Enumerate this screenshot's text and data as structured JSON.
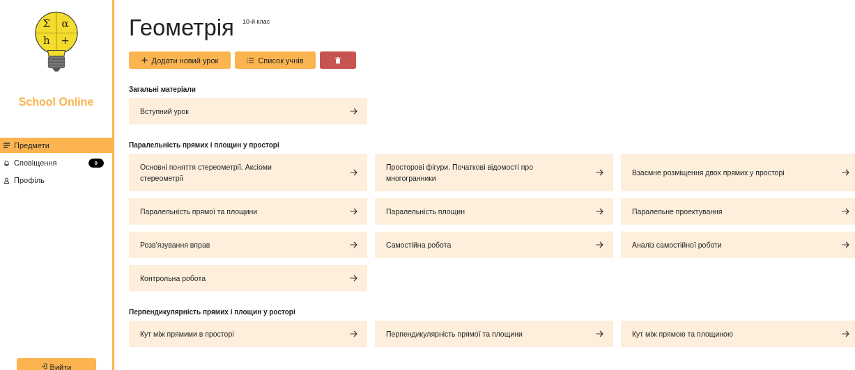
{
  "sidebar": {
    "logo_symbols": [
      "Σ",
      "α",
      "h",
      "+"
    ],
    "brand": "School Online",
    "nav": [
      {
        "kind": "subjects",
        "label": "Предмети",
        "selected": true
      },
      {
        "kind": "notifications",
        "label": "Сповіщення",
        "badge": "0",
        "selected": false
      },
      {
        "kind": "profile",
        "label": "Профіль",
        "selected": false
      }
    ],
    "logout": "Вийти"
  },
  "header": {
    "title": "Геометрія",
    "grade": "10-й клас"
  },
  "actions": [
    {
      "kind": "add",
      "label": "Додати новий урок"
    },
    {
      "kind": "list",
      "label": "Список учнів"
    },
    {
      "kind": "delete"
    }
  ],
  "sections": [
    {
      "title": "Загальні матеріали",
      "lessons": [
        "Вступний урок"
      ]
    },
    {
      "title": "Паралельність прямих і площин у просторі",
      "lessons": [
        "Основні поняття стереометрії. Аксіоми стереометрії",
        "Просторові фігури. Початкові відомості про многогранники",
        "Взаємне розміщення двох прямих у просторі",
        "Паралельність прямої та площини",
        "Паралельність площин",
        "Паралельне проектування",
        "Розв'язування вправ",
        "Самостійна робота",
        "Аналіз самостійної роботи",
        "Контрольна робота"
      ]
    },
    {
      "title": "Перпендикулярність прямих і площин у росторі",
      "lessons": [
        "Кут між прямими в просторі",
        "Перпендикулярність прямої та площини",
        "Кут між прямою та площиною"
      ]
    }
  ]
}
